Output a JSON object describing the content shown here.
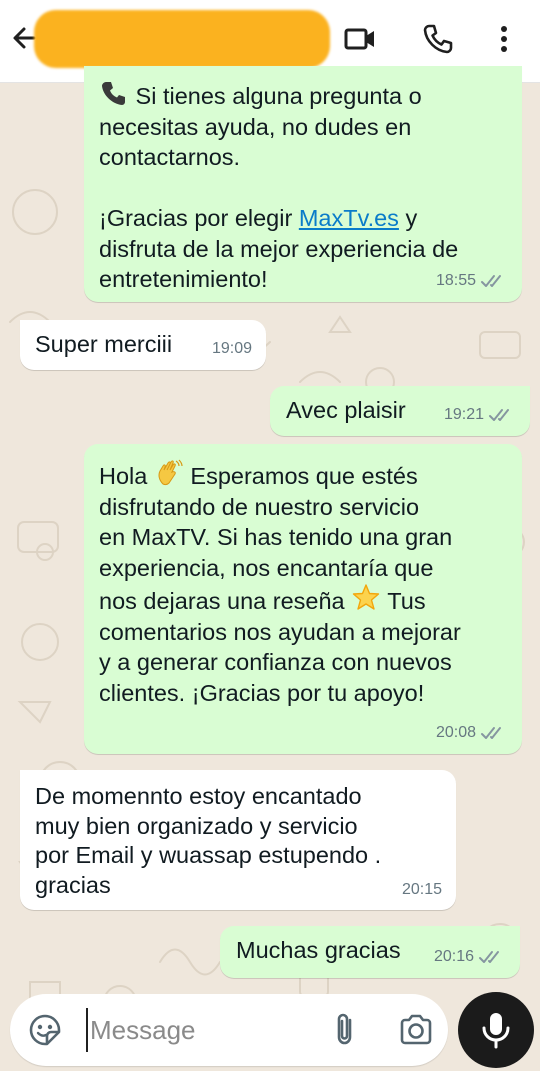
{
  "header": {
    "back_icon": "arrow-left-icon",
    "contact_name_redacted": true,
    "actions": [
      "video-call-icon",
      "voice-call-icon",
      "more-vert-icon"
    ]
  },
  "colors": {
    "outgoing_bubble": "#d9fdd3",
    "incoming_bubble": "#ffffff",
    "wallpaper": "#efe7dc",
    "redaction": "#fbb21f",
    "link": "#0a7cc9"
  },
  "messages": [
    {
      "direction": "outgoing",
      "text_line1": "Si tienes alguna pregunta o",
      "text_rest": "necesitas ayuda, no dudes en\ncontactarnos.",
      "text_2a": "¡Gracias por elegir ",
      "link": "MaxTv.es",
      "text_2b": " y\ndisfruta de la mejor experiencia de\nentretenimiento!",
      "time": "18:55",
      "icon": "telephone-receiver-emoji"
    },
    {
      "direction": "incoming",
      "text": "Super merciii",
      "time": "19:09"
    },
    {
      "direction": "outgoing",
      "text": "Avec plaisir",
      "time": "19:21"
    },
    {
      "direction": "outgoing",
      "text_a": "Hola ",
      "text_b": " Esperamos que estés\ndisfrutando de nuestro servicio\nen MaxTV. Si has tenido una gran\nexperiencia, nos encantaría que\nnos dejaras una reseña ",
      "text_c": " Tus\ncomentarios nos ayudan a mejorar\ny a generar confianza con nuevos\nclientes. ¡Gracias por tu apoyo!",
      "time": "20:08",
      "emojis": [
        "waving-hand-emoji",
        "glowing-star-emoji"
      ]
    },
    {
      "direction": "incoming",
      "text": "De momennto estoy encantado\nmuy bien organizado y servicio\npor Email y wuassap estupendo .\ngracias",
      "time": "20:15"
    },
    {
      "direction": "outgoing",
      "text": "Muchas gracias",
      "time": "20:16"
    }
  ],
  "composer": {
    "placeholder": "Message",
    "value": "",
    "icons": [
      "sticker-icon",
      "attach-icon",
      "camera-icon",
      "mic-icon"
    ]
  }
}
